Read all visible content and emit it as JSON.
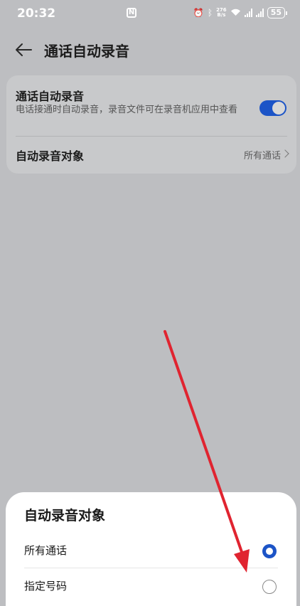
{
  "status_bar": {
    "time": "20:32",
    "nfc": "N",
    "net_speed_top": "276",
    "net_speed_bottom": "B/s",
    "battery": "55"
  },
  "header": {
    "title": "通话自动录音"
  },
  "settings": {
    "auto_record_title": "通话自动录音",
    "auto_record_desc": "电话接通时自动录音，录音文件可在录音机应用中查看",
    "auto_record_enabled": true,
    "target_label": "自动录音对象",
    "target_value": "所有通话"
  },
  "sheet": {
    "title": "自动录音对象",
    "options": [
      {
        "label": "所有通话",
        "selected": true
      },
      {
        "label": "指定号码",
        "selected": false
      }
    ]
  },
  "colors": {
    "accent": "#1c54c7",
    "annotation": "#e02430"
  }
}
